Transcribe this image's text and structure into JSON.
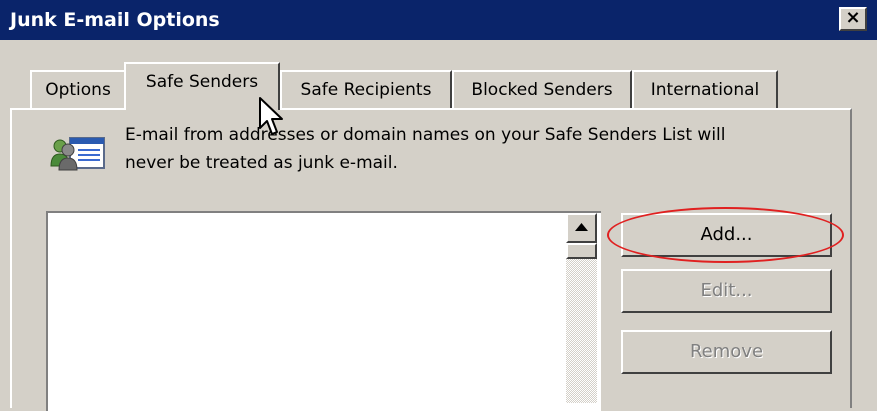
{
  "window": {
    "title": "Junk E-mail Options",
    "close_glyph": "×"
  },
  "tabs": [
    {
      "label": "Options",
      "active": false
    },
    {
      "label": "Safe Senders",
      "active": true
    },
    {
      "label": "Safe Recipients",
      "active": false
    },
    {
      "label": "Blocked Senders",
      "active": false
    },
    {
      "label": "International",
      "active": false
    }
  ],
  "description": {
    "icon": "contacts-list-icon",
    "line1": "E-mail from addresses or domain names on your Safe Senders List will",
    "line2": "never be treated as junk e-mail."
  },
  "buttons": {
    "add": {
      "label": "Add...",
      "enabled": true
    },
    "edit": {
      "label": "Edit...",
      "enabled": false
    },
    "remove": {
      "label": "Remove",
      "enabled": false
    }
  },
  "annotation": {
    "color": "#e02020",
    "target": "add"
  },
  "colors": {
    "titlebar": "#0a246a",
    "face": "#d4d0c8"
  }
}
